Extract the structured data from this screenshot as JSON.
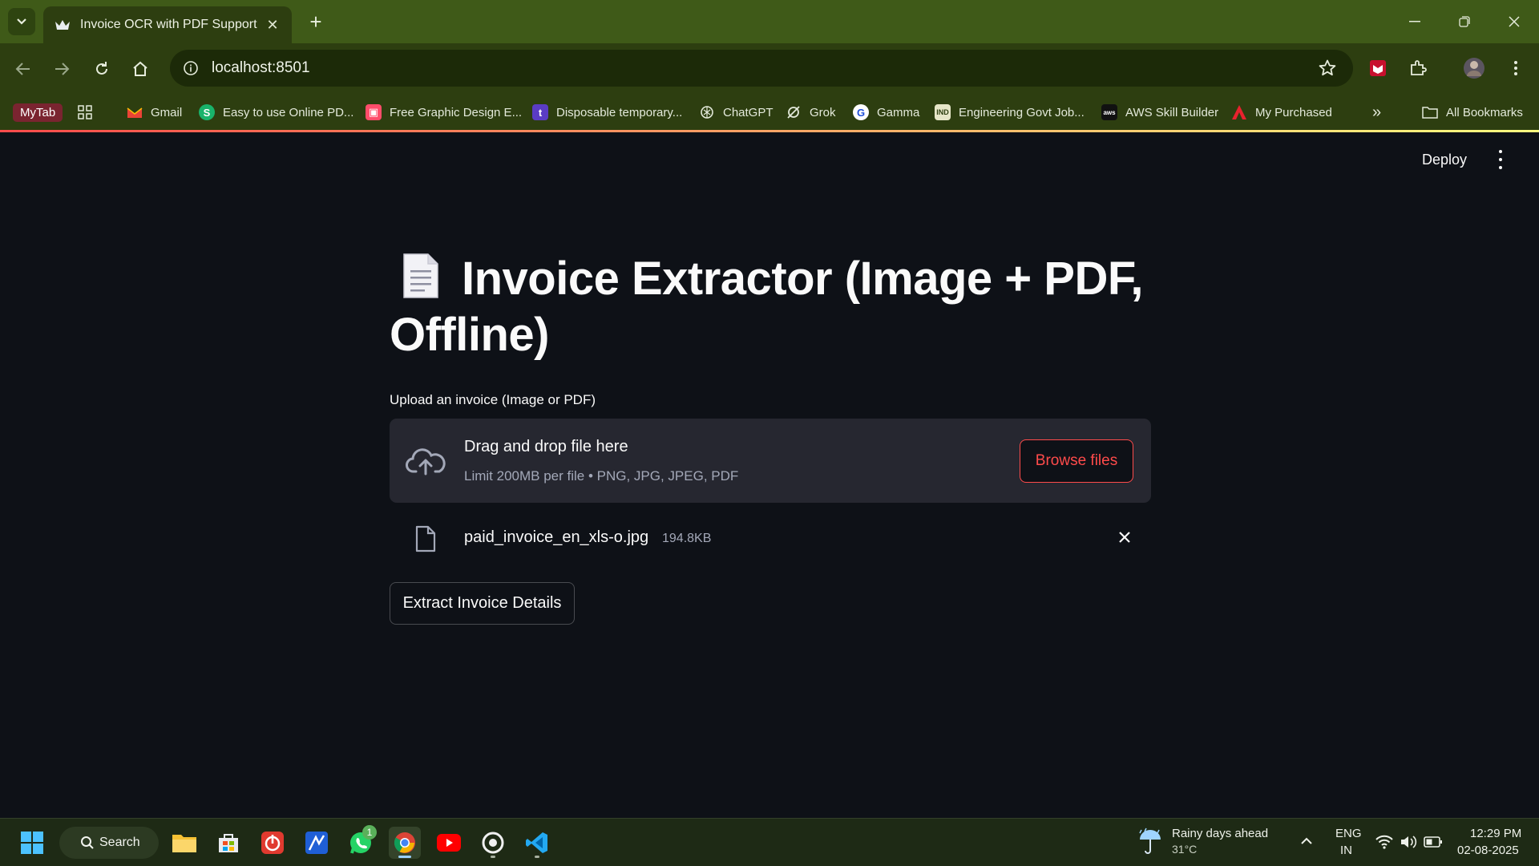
{
  "browser": {
    "tab_title": "Invoice OCR with PDF Support",
    "url": "localhost:8501",
    "bookmarks": [
      {
        "label": "MyTab"
      },
      {
        "label": "Gmail"
      },
      {
        "label": "Easy to use Online PD..."
      },
      {
        "label": "Free Graphic Design E..."
      },
      {
        "label": "Disposable temporary..."
      },
      {
        "label": "ChatGPT"
      },
      {
        "label": "Grok"
      },
      {
        "label": "Gamma"
      },
      {
        "label": "Engineering Govt Job..."
      },
      {
        "label": "AWS Skill Builder"
      },
      {
        "label": "My Purchased"
      }
    ],
    "more_bookmarks": "»",
    "all_bookmarks": "All Bookmarks"
  },
  "app": {
    "deploy_label": "Deploy",
    "title": "Invoice Extractor (Image + PDF, Offline)",
    "uploader": {
      "label": "Upload an invoice (Image or PDF)",
      "drop_title": "Drag and drop file here",
      "drop_hint": "Limit 200MB per file • PNG, JPG, JPEG, PDF",
      "browse_label": "Browse files"
    },
    "uploaded_file": {
      "name": "paid_invoice_en_xls-o.jpg",
      "size": "194.8KB"
    },
    "extract_button": "Extract Invoice Details"
  },
  "taskbar": {
    "search_label": "Search",
    "whatsapp_badge": "1",
    "weather_title": "Rainy days ahead",
    "weather_temp": "31°C",
    "lang_1": "ENG",
    "lang_2": "IN",
    "time": "12:29 PM",
    "date": "02-08-2025"
  },
  "colors": {
    "accent": "#ff4b4b",
    "app_background": "#0e1117",
    "dropzone": "#262730",
    "browser_frame": "#3f5a18"
  }
}
